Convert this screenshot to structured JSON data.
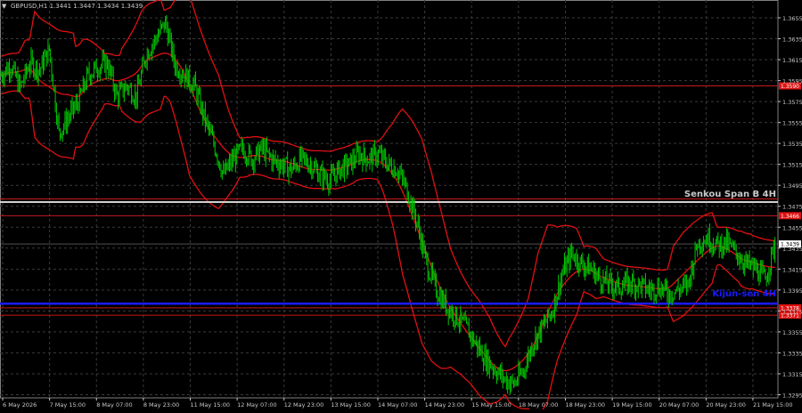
{
  "header": {
    "symbol_text": "GBPUSD,H1  1.3441 1.3447 1.3434 1.3439",
    "triangle_glyph": "▼"
  },
  "colors": {
    "background": "#000000",
    "grid": "#3a3a3a",
    "axis_text": "#c8c8c8",
    "bull_candle": "#00c800",
    "bear_candle": "#00c800",
    "bands": "#e01010",
    "level_red": "#c81a1a",
    "senkou": "#d0d0d0",
    "kijun": "#1a1aff",
    "price_tag": "#e01010"
  },
  "chart_data": {
    "type": "candlestick",
    "symbol": "GBPUSD",
    "timeframe": "H1",
    "ohlc_header": {
      "open": 1.3441,
      "high": 1.3447,
      "low": 1.3434,
      "close": 1.3439
    },
    "ylim": [
      1.3292,
      1.3672
    ],
    "y_ticks": [
      "1.3655",
      "1.3635",
      "1.3615",
      "1.3595",
      "1.3575",
      "1.3555",
      "1.3535",
      "1.3515",
      "1.3495",
      "1.3475",
      "1.3455",
      "1.3435",
      "1.3415",
      "1.3395",
      "1.3375",
      "1.3355",
      "1.3335",
      "1.3315",
      "1.3295"
    ],
    "x_ticks": [
      "6 May 2026",
      "7 May 15:00",
      "8 May 07:00",
      "8 May 23:00",
      "11 May 15:00",
      "12 May 07:00",
      "12 May 23:00",
      "13 May 15:00",
      "14 May 07:00",
      "14 May 23:00",
      "15 May 15:00",
      "18 May 07:00",
      "18 May 23:00",
      "19 May 15:00",
      "20 May 07:00",
      "20 May 23:00",
      "21 May 15:00"
    ],
    "current_price": {
      "label": "1.3439",
      "value": 1.3439
    },
    "levels": [
      {
        "name": "Senkou Span B 4H",
        "value": 1.3479,
        "color": "#d0d0d0",
        "tag": ""
      },
      {
        "name": "red-level-1",
        "value": 1.3482,
        "color": "#c81a1a",
        "tag": ""
      },
      {
        "name": "red-level-2",
        "value": 1.3466,
        "color": "#c81a1a",
        "tag": "1.3466"
      },
      {
        "name": "red-level-3",
        "value": 1.359,
        "color": "#c81a1a",
        "tag": "1.3590"
      },
      {
        "name": "Kijun-sen 4H",
        "value": 1.3382,
        "color": "#1a1aff",
        "tag": ""
      },
      {
        "name": "red-level-4",
        "value": 1.3378,
        "color": "#c81a1a",
        "tag": "1.3378"
      },
      {
        "name": "red-level-5",
        "value": 1.3371,
        "color": "#c81a1a",
        "tag": "1.3371"
      }
    ],
    "level_labels": {
      "senkou": "Senkou Span B 4H",
      "kijun": "Kijun-sen 4H"
    },
    "close_anchors": [
      [
        0,
        1.36
      ],
      [
        8,
        1.361
      ],
      [
        16,
        1.3588
      ],
      [
        24,
        1.3612
      ],
      [
        32,
        1.3605
      ],
      [
        40,
        1.3625
      ],
      [
        48,
        1.3545
      ],
      [
        56,
        1.356
      ],
      [
        64,
        1.3575
      ],
      [
        72,
        1.36
      ],
      [
        80,
        1.3608
      ],
      [
        88,
        1.3612
      ],
      [
        96,
        1.358
      ],
      [
        104,
        1.359
      ],
      [
        112,
        1.358
      ],
      [
        120,
        1.362
      ],
      [
        128,
        1.3635
      ],
      [
        136,
        1.365
      ],
      [
        144,
        1.361
      ],
      [
        152,
        1.36
      ],
      [
        160,
        1.359
      ],
      [
        168,
        1.356
      ],
      [
        176,
        1.3535
      ],
      [
        184,
        1.3505
      ],
      [
        192,
        1.352
      ],
      [
        200,
        1.353
      ],
      [
        208,
        1.352
      ],
      [
        216,
        1.353
      ],
      [
        224,
        1.352
      ],
      [
        232,
        1.3515
      ],
      [
        240,
        1.351
      ],
      [
        248,
        1.352
      ],
      [
        256,
        1.3515
      ],
      [
        264,
        1.3505
      ],
      [
        272,
        1.35
      ],
      [
        280,
        1.351
      ],
      [
        288,
        1.3515
      ],
      [
        296,
        1.3525
      ],
      [
        304,
        1.352
      ],
      [
        312,
        1.3525
      ],
      [
        320,
        1.3515
      ],
      [
        328,
        1.351
      ],
      [
        336,
        1.349
      ],
      [
        344,
        1.346
      ],
      [
        352,
        1.342
      ],
      [
        360,
        1.3395
      ],
      [
        368,
        1.338
      ],
      [
        376,
        1.337
      ],
      [
        384,
        1.336
      ],
      [
        392,
        1.3345
      ],
      [
        400,
        1.333
      ],
      [
        408,
        1.332
      ],
      [
        416,
        1.331
      ],
      [
        424,
        1.3305
      ],
      [
        432,
        1.3318
      ],
      [
        440,
        1.3345
      ],
      [
        448,
        1.336
      ],
      [
        456,
        1.3375
      ],
      [
        464,
        1.341
      ],
      [
        472,
        1.343
      ],
      [
        480,
        1.342
      ],
      [
        488,
        1.3415
      ],
      [
        496,
        1.3405
      ],
      [
        504,
        1.34
      ],
      [
        512,
        1.3398
      ],
      [
        520,
        1.3402
      ],
      [
        528,
        1.34
      ],
      [
        536,
        1.3395
      ],
      [
        544,
        1.3398
      ],
      [
        552,
        1.3392
      ],
      [
        560,
        1.3395
      ],
      [
        568,
        1.34
      ],
      [
        576,
        1.344
      ],
      [
        584,
        1.3445
      ],
      [
        592,
        1.3438
      ],
      [
        600,
        1.344
      ],
      [
        608,
        1.343
      ],
      [
        616,
        1.342
      ],
      [
        624,
        1.3415
      ],
      [
        632,
        1.3405
      ],
      [
        640,
        1.3439
      ]
    ]
  }
}
